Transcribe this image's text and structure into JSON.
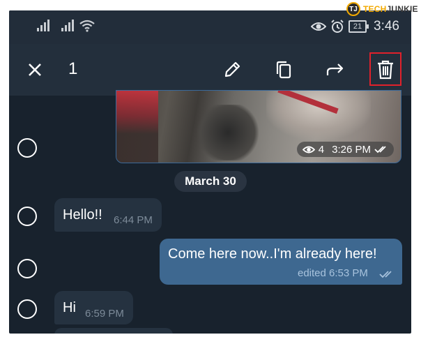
{
  "status_bar": {
    "battery": "21",
    "time": "3:46",
    "icons": [
      "signal-icon",
      "signal-icon",
      "wifi-icon",
      "eye-icon",
      "alarm-icon",
      "battery-icon"
    ]
  },
  "watermark": {
    "logo": "TJ",
    "tech": "TECH",
    "junkie": "JUNKIE"
  },
  "action_bar": {
    "selected_count": "1",
    "icons": [
      "close-icon",
      "pencil-icon",
      "copy-icon",
      "forward-icon",
      "trash-icon"
    ]
  },
  "chat": {
    "photo_message": {
      "views": "4",
      "time": "3:26 PM"
    },
    "date_separator": "March 30",
    "messages": [
      {
        "direction": "in",
        "text": "Hello!!",
        "time": "6:44 PM"
      },
      {
        "direction": "out",
        "text": "Come here now..I'm already here!",
        "time": "edited 6:53 PM"
      },
      {
        "direction": "in",
        "text": "Hi",
        "time": "6:59 PM"
      }
    ]
  },
  "colors": {
    "background": "#18222d",
    "toolbar": "#232f3c",
    "incoming_bubble": "#253240",
    "outgoing_bubble": "#3e6890",
    "highlight_box": "#e0212b"
  }
}
